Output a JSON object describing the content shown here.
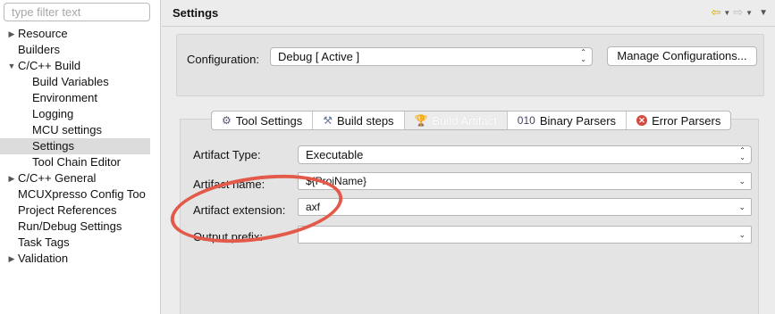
{
  "sidebar": {
    "filter_placeholder": "type filter text",
    "items": [
      {
        "label": "Resource",
        "twisty": "▶"
      },
      {
        "label": "Builders",
        "twisty": ""
      },
      {
        "label": "C/C++ Build",
        "twisty": "▼"
      },
      {
        "label": "Build Variables",
        "twisty": ""
      },
      {
        "label": "Environment",
        "twisty": ""
      },
      {
        "label": "Logging",
        "twisty": ""
      },
      {
        "label": "MCU settings",
        "twisty": ""
      },
      {
        "label": "Settings",
        "twisty": ""
      },
      {
        "label": "Tool Chain Editor",
        "twisty": ""
      },
      {
        "label": "C/C++ General",
        "twisty": "▶"
      },
      {
        "label": "MCUXpresso Config Too",
        "twisty": ""
      },
      {
        "label": "Project References",
        "twisty": ""
      },
      {
        "label": "Run/Debug Settings",
        "twisty": ""
      },
      {
        "label": "Task Tags",
        "twisty": ""
      },
      {
        "label": "Validation",
        "twisty": "▶"
      }
    ]
  },
  "header": {
    "title": "Settings",
    "back_glyph": "⇦",
    "forward_glyph": "⇨",
    "dropdown_glyph": "▼"
  },
  "configuration": {
    "label": "Configuration:",
    "value": "Debug  [ Active ]",
    "manage_button": "Manage Configurations..."
  },
  "tabs": [
    {
      "label": "Tool Settings",
      "icon": "tool-settings-icon",
      "glyph": "⚙"
    },
    {
      "label": "Build steps",
      "icon": "build-steps-icon",
      "glyph": "⚒"
    },
    {
      "label": "Build Artifact",
      "icon": "build-artifact-icon",
      "glyph": "🏆",
      "active": true
    },
    {
      "label": "Binary Parsers",
      "icon": "binary-parsers-icon",
      "glyph": "010"
    },
    {
      "label": "Error Parsers",
      "icon": "error-parsers-icon",
      "glyph": "✕"
    }
  ],
  "fields": {
    "artifact_type": {
      "label": "Artifact Type:",
      "value": "Executable"
    },
    "artifact_name": {
      "label": "Artifact name:",
      "value": "${ProjName}"
    },
    "artifact_extension": {
      "label": "Artifact extension:",
      "value": "axf"
    },
    "output_prefix": {
      "label": "Output prefix:",
      "value": ""
    }
  },
  "annotation": {
    "color": "#e35a4b"
  },
  "colors": {
    "selection": "#dcdcdc",
    "panel": "#e4e4e4"
  }
}
